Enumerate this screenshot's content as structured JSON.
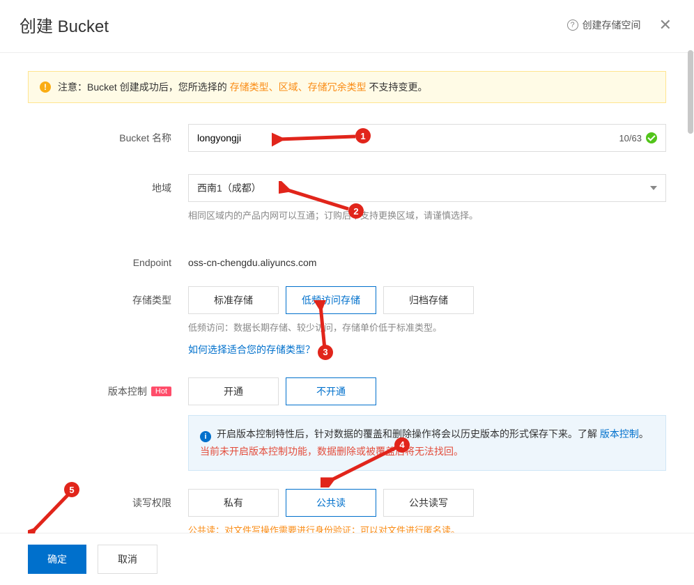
{
  "header": {
    "title": "创建 Bucket",
    "help_link": "创建存储空间"
  },
  "notice": {
    "prefix": "注意：Bucket 创建成功后，您所选择的 ",
    "highlight": "存储类型、区域、存储冗余类型",
    "suffix": " 不支持变更。"
  },
  "form": {
    "bucket_name": {
      "label": "Bucket 名称",
      "value": "longyongji",
      "counter": "10/63"
    },
    "region": {
      "label": "地域",
      "value": "西南1（成都）",
      "hint": "相同区域内的产品内网可以互通；订购后不支持更换区域，请谨慎选择。"
    },
    "endpoint": {
      "label": "Endpoint",
      "value": "oss-cn-chengdu.aliyuncs.com"
    },
    "storage_type": {
      "label": "存储类型",
      "options": [
        "标准存储",
        "低频访问存储",
        "归档存储"
      ],
      "selected": 1,
      "hint": "低频访问：数据长期存储、较少访问，存储单价低于标准类型。",
      "link": "如何选择适合您的存储类型？"
    },
    "versioning": {
      "label": "版本控制",
      "badge": "Hot",
      "options": [
        "开通",
        "不开通"
      ],
      "selected": 1,
      "info_text": "开启版本控制特性后，针对数据的覆盖和删除操作将会以历史版本的形式保存下来。了解 ",
      "info_link": "版本控制",
      "info_suffix": "。",
      "warn_text": "当前未开启版本控制功能，数据删除或被覆盖后将无法找回。"
    },
    "acl": {
      "label": "读写权限",
      "options": [
        "私有",
        "公共读",
        "公共读写"
      ],
      "selected": 1,
      "hint": "公共读：对文件写操作需要进行身份验证；可以对文件进行匿名读。"
    }
  },
  "footer": {
    "confirm": "确定",
    "cancel": "取消"
  },
  "annotations": [
    "1",
    "2",
    "3",
    "4",
    "5"
  ]
}
